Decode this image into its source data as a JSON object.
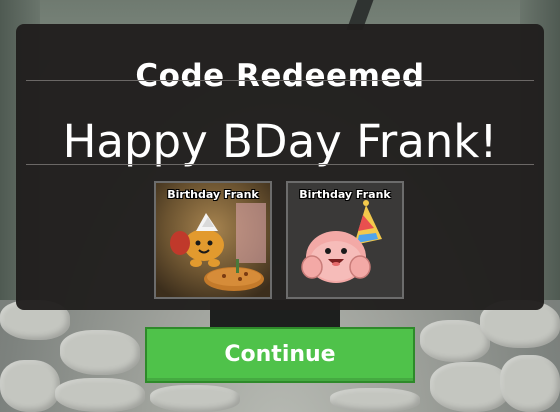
{
  "modal": {
    "title": "Code Redeemed",
    "code_text": "Happy BDay Frank!"
  },
  "rewards": [
    {
      "name": "Birthday Frank",
      "icon": "birthday-frank-scene-icon"
    },
    {
      "name": "Birthday Frank",
      "icon": "birthday-frank-party-hat-icon"
    }
  ],
  "continue_button": {
    "label": "Continue",
    "color": "#4fc24a"
  },
  "colors": {
    "modal_background": "#201e1d",
    "text": "#ffffff",
    "card_border": "#6c6c6c"
  }
}
